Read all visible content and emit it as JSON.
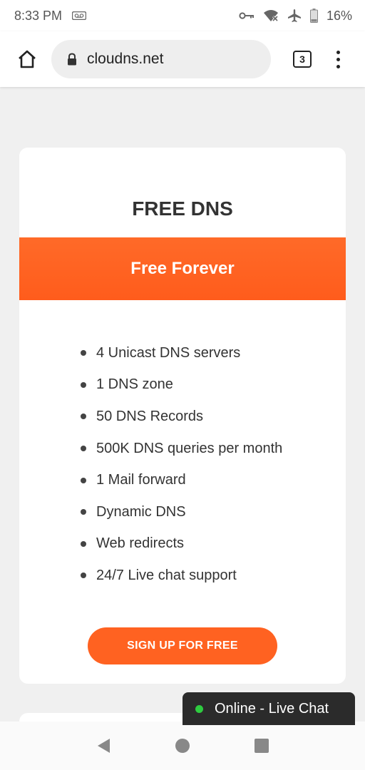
{
  "status_bar": {
    "time": "8:33 PM",
    "battery": "16%",
    "icons": [
      "voicemail-icon",
      "key-icon",
      "wifi-off-icon",
      "airplane-icon",
      "battery-icon"
    ]
  },
  "browser": {
    "url": "cloudns.net",
    "tab_count": "3",
    "icons": [
      "home-icon",
      "lock-icon",
      "tabs-icon",
      "more-vert-icon"
    ]
  },
  "plan": {
    "title": "FREE DNS",
    "banner": "Free Forever",
    "accent_color": "#ff6221",
    "features": [
      "4 Unicast DNS servers",
      "1 DNS zone",
      "50 DNS Records",
      "500K DNS queries per month",
      "1 Mail forward",
      "Dynamic DNS",
      "Web redirects",
      "24/7 Live chat support"
    ],
    "cta_label": "SIGN UP FOR FREE"
  },
  "live_chat": {
    "label": "Online - Live Chat",
    "status_color": "#2ecc40"
  },
  "nav_bar": {
    "icons": [
      "back-icon",
      "home-circle-icon",
      "recents-icon"
    ]
  }
}
